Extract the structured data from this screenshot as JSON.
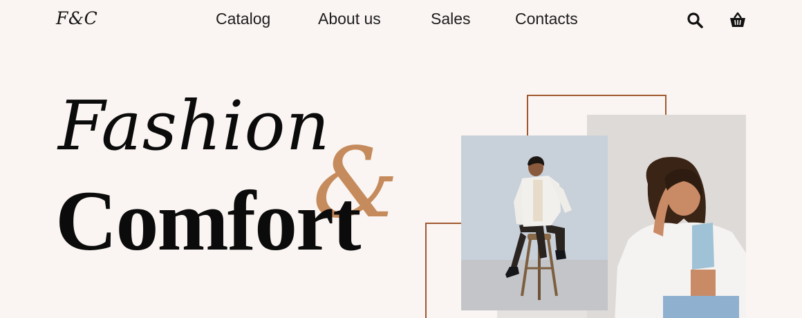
{
  "header": {
    "logo": "F&C",
    "nav": [
      {
        "label": "Catalog"
      },
      {
        "label": "About us"
      },
      {
        "label": "Sales"
      },
      {
        "label": "Contacts"
      }
    ],
    "icons": {
      "search": "search-icon",
      "cart": "basket-icon"
    }
  },
  "hero": {
    "line1": "Fashion",
    "ampersand": "&",
    "line2": "Comfort"
  },
  "colors": {
    "background": "#faf5f2",
    "accent": "#c58b5c",
    "frame": "#a0582e",
    "text": "#0b0b0b"
  }
}
